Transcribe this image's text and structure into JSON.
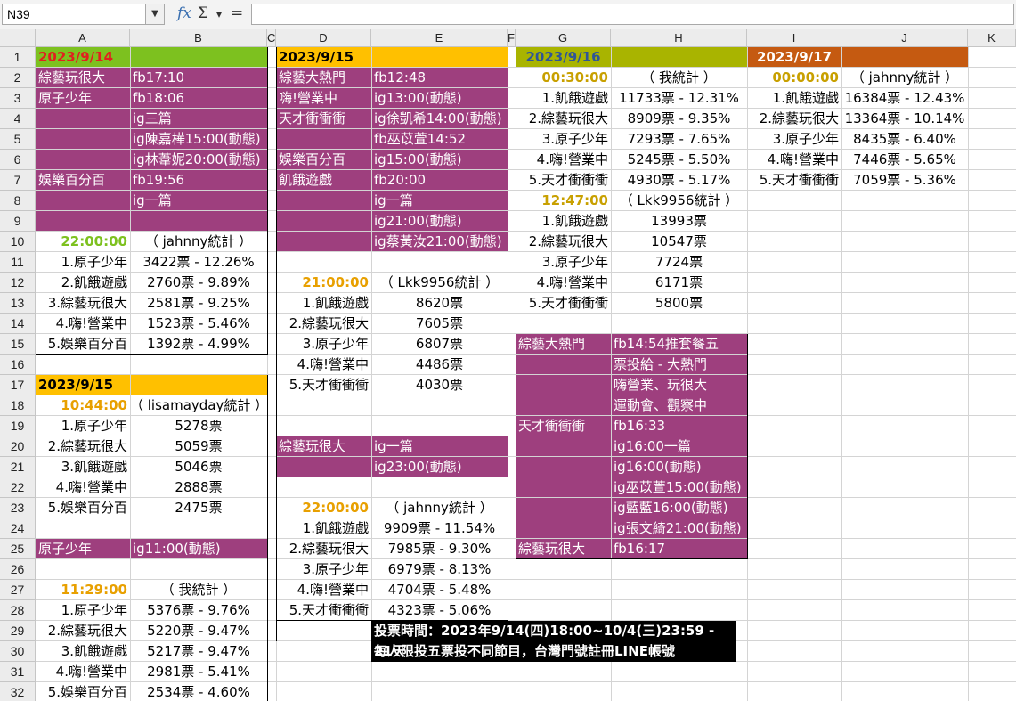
{
  "toolbar": {
    "namebox": "N39",
    "fx": "𝑓x",
    "sigma": "Σ",
    "sigma_drop": "▾",
    "equals": "=",
    "formula": ""
  },
  "colors": {
    "magenta": "#9e3f7e",
    "green_header": "#7dc11f",
    "orange_header": "#ffc000",
    "olive_header": "#a9b400",
    "brown_header": "#c55a11",
    "time_orange": "#e8a000"
  },
  "columns": [
    "A",
    "B",
    "C",
    "D",
    "E",
    "F",
    "G",
    "H",
    "I",
    "J",
    "K"
  ],
  "rows": [
    "1",
    "2",
    "3",
    "4",
    "5",
    "6",
    "7",
    "8",
    "9",
    "10",
    "11",
    "12",
    "13",
    "14",
    "15",
    "16",
    "17",
    "18",
    "19",
    "20",
    "21",
    "22",
    "23",
    "24",
    "25",
    "26",
    "27",
    "28",
    "29",
    "30",
    "31",
    "32"
  ],
  "sections": {
    "d0914": {
      "date": "2023/9/14",
      "posts": [
        [
          "綜藝玩很大",
          "fb17:10"
        ],
        [
          "原子少年",
          "fb18:06"
        ],
        [
          "",
          "ig三篇"
        ],
        [
          "",
          "ig陳嘉樺15:00(動態)"
        ],
        [
          "",
          "ig林葦妮20:00(動態)"
        ],
        [
          "娛樂百分百",
          "fb19:56"
        ],
        [
          "",
          "ig一篇"
        ],
        [
          "",
          ""
        ]
      ],
      "stat1_time": "22:00:00",
      "stat1_by": "（ jahnny統計 ）",
      "stat1": [
        [
          "1.原子少年",
          "3422票 -  12.26%"
        ],
        [
          "2.飢餓遊戲",
          "2760票 - 9.89%"
        ],
        [
          "3.綜藝玩很大",
          "2581票 - 9.25%"
        ],
        [
          "4.嗨!營業中",
          "1523票 - 5.46%"
        ],
        [
          "5.娛樂百分百",
          "1392票 - 4.99%"
        ]
      ]
    },
    "d0915a": {
      "date": "2023/9/15",
      "stat_time": "10:44:00",
      "stat_by": "（ lisamayday統計 ）",
      "stat": [
        [
          "1.原子少年",
          "5278票"
        ],
        [
          "2.綜藝玩很大",
          "5059票"
        ],
        [
          "3.飢餓遊戲",
          "5046票"
        ],
        [
          "4.嗨!營業中",
          "2888票"
        ],
        [
          "5.娛樂百分百",
          "2475票"
        ]
      ],
      "post": [
        "原子少年",
        "ig11:00(動態)"
      ],
      "stat2_time": "11:29:00",
      "stat2_by": "（ 我統計 ）",
      "stat2": [
        [
          "1.原子少年",
          "5376票 - 9.76%"
        ],
        [
          "2.綜藝玩很大",
          "5220票 - 9.47%"
        ],
        [
          "3.飢餓遊戲",
          "5217票 - 9.47%"
        ],
        [
          "4.嗨!營業中",
          "2981票 - 5.41%"
        ],
        [
          "5.娛樂百分百",
          "2534票 - 4.60%"
        ]
      ]
    },
    "d0915b": {
      "date": "2023/9/15",
      "posts": [
        [
          "綜藝大熱門",
          "fb12:48"
        ],
        [
          "嗨!營業中",
          "ig13:00(動態)"
        ],
        [
          "天才衝衝衝",
          "ig徐凱希14:00(動態)"
        ],
        [
          "",
          "fb巫苡萱14:52"
        ],
        [
          "娛樂百分百",
          "ig15:00(動態)"
        ],
        [
          "飢餓遊戲",
          "fb20:00"
        ],
        [
          "",
          "ig一篇"
        ],
        [
          "",
          "ig21:00(動態)"
        ],
        [
          "",
          "ig蔡黃汝21:00(動態)"
        ]
      ],
      "stat1_time": "21:00:00",
      "stat1_by": "（ Lkk9956統計 ）",
      "stat1": [
        [
          "1.飢餓遊戲",
          "8620票"
        ],
        [
          "2.綜藝玩很大",
          "7605票"
        ],
        [
          "3.原子少年",
          "6807票"
        ],
        [
          "4.嗨!營業中",
          "4486票"
        ],
        [
          "5.天才衝衝衝",
          "4030票"
        ]
      ],
      "posts2": [
        [
          "綜藝玩很大",
          "ig一篇"
        ],
        [
          "",
          "ig23:00(動態)"
        ]
      ],
      "stat2_time": "22:00:00",
      "stat2_by": "（ jahnny統計 ）",
      "stat2": [
        [
          "1.飢餓遊戲",
          "9909票 - 11.54%"
        ],
        [
          "2.綜藝玩很大",
          "7985票 - 9.30%"
        ],
        [
          "3.原子少年",
          "6979票 - 8.13%"
        ],
        [
          "4.嗨!營業中",
          "4704票 - 5.48%"
        ],
        [
          "5.天才衝衝衝",
          "4323票 - 5.06%"
        ]
      ]
    },
    "d0916": {
      "date": "2023/9/16",
      "stat1_time": "00:30:00",
      "stat1_by": "（ 我統計 ）",
      "stat1": [
        [
          "1.飢餓遊戲",
          "11733票 - 12.31%"
        ],
        [
          "2.綜藝玩很大",
          "8909票 - 9.35%"
        ],
        [
          "3.原子少年",
          "7293票 - 7.65%"
        ],
        [
          "4.嗨!營業中",
          "5245票 - 5.50%"
        ],
        [
          "5.天才衝衝衝",
          "4930票 - 5.17%"
        ]
      ],
      "stat2_time": "12:47:00",
      "stat2_by": "（ Lkk9956統計 ）",
      "stat2": [
        [
          "1.飢餓遊戲",
          "13993票"
        ],
        [
          "2.綜藝玩很大",
          "10547票"
        ],
        [
          "3.原子少年",
          "7724票"
        ],
        [
          "4.嗨!營業中",
          "6171票"
        ],
        [
          "5.天才衝衝衝",
          "5800票"
        ]
      ],
      "posts": [
        [
          "綜藝大熱門",
          "fb14:54推套餐五"
        ],
        [
          "",
          "票投給 - 大熱門"
        ],
        [
          "",
          "嗨營業、玩很大"
        ],
        [
          "",
          "運動會、觀察中"
        ],
        [
          "天才衝衝衝",
          "fb16:33"
        ],
        [
          "",
          "ig16:00一篇"
        ],
        [
          "",
          "ig16:00(動態)"
        ],
        [
          "",
          "ig巫苡萱15:00(動態)"
        ],
        [
          "",
          "ig藍藍16:00(動態)"
        ],
        [
          "",
          "ig張文綺21:00(動態)"
        ],
        [
          "綜藝玩很大",
          "fb16:17"
        ]
      ]
    },
    "d0917": {
      "date": "2023/9/17",
      "stat_time": "00:00:00",
      "stat_by": "（ jahnny統計 ）",
      "stat": [
        [
          "1.飢餓遊戲",
          "16384票 - 12.43%"
        ],
        [
          "2.綜藝玩很大",
          "13364票 - 10.14%"
        ],
        [
          "3.原子少年",
          "8435票 - 6.40%"
        ],
        [
          "4.嗨!營業中",
          "7446票 - 5.65%"
        ],
        [
          "5.天才衝衝衝",
          "7059票 - 5.36%"
        ]
      ]
    }
  },
  "note": {
    "line1": "投票時間：2023年9/14(四)18:00~10/4(三)23:59 - 21天",
    "line2": "每人限投五票投不同節目，台灣門號註冊LINE帳號"
  }
}
